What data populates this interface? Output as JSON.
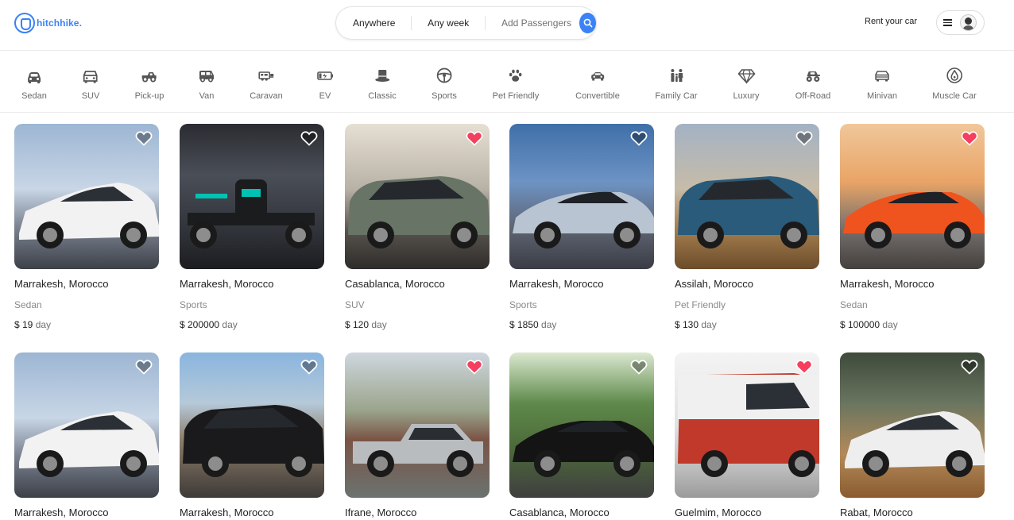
{
  "brand": {
    "name": "hitchhike.",
    "accent": "#3b82f6"
  },
  "search": {
    "where": "Anywhere",
    "when": "Any week",
    "who": "Add Passengers"
  },
  "header": {
    "rent_label": "Rent your car"
  },
  "categories": [
    {
      "label": "Sedan",
      "icon": "sedan-icon"
    },
    {
      "label": "SUV",
      "icon": "suv-icon"
    },
    {
      "label": "Pick-up",
      "icon": "pickup-icon"
    },
    {
      "label": "Van",
      "icon": "van-icon"
    },
    {
      "label": "Caravan",
      "icon": "caravan-icon"
    },
    {
      "label": "EV",
      "icon": "battery-icon"
    },
    {
      "label": "Classic",
      "icon": "top-hat-icon"
    },
    {
      "label": "Sports",
      "icon": "steering-wheel-icon"
    },
    {
      "label": "Pet Friendly",
      "icon": "paw-icon"
    },
    {
      "label": "Convertible",
      "icon": "convertible-icon"
    },
    {
      "label": "Family Car",
      "icon": "family-icon"
    },
    {
      "label": "Luxury",
      "icon": "diamond-icon"
    },
    {
      "label": "Off-Road",
      "icon": "monster-truck-icon"
    },
    {
      "label": "Minivan",
      "icon": "minivan-icon"
    },
    {
      "label": "Muscle Car",
      "icon": "fuel-drop-icon"
    }
  ],
  "listings": [
    {
      "location": "Marrakesh, Morocco",
      "category": "Sedan",
      "price": "$ 19",
      "unit": "day",
      "favorited": false
    },
    {
      "location": "Marrakesh, Morocco",
      "category": "Sports",
      "price": "$ 200000",
      "unit": "day",
      "favorited": false
    },
    {
      "location": "Casablanca, Morocco",
      "category": "SUV",
      "price": "$ 120",
      "unit": "day",
      "favorited": true
    },
    {
      "location": "Marrakesh, Morocco",
      "category": "Sports",
      "price": "$ 1850",
      "unit": "day",
      "favorited": false
    },
    {
      "location": "Assilah, Morocco",
      "category": "Pet Friendly",
      "price": "$ 130",
      "unit": "day",
      "favorited": false
    },
    {
      "location": "Marrakesh, Morocco",
      "category": "Sedan",
      "price": "$ 100000",
      "unit": "day",
      "favorited": true
    },
    {
      "location": "Marrakesh, Morocco",
      "favorited": false
    },
    {
      "location": "Marrakesh, Morocco",
      "favorited": false
    },
    {
      "location": "Ifrane, Morocco",
      "favorited": true
    },
    {
      "location": "Casablanca, Morocco",
      "favorited": false
    },
    {
      "location": "Guelmim, Morocco",
      "favorited": true
    },
    {
      "location": "Rabat, Morocco",
      "favorited": false
    }
  ],
  "colors": {
    "favorite": "#f43f5e",
    "text_muted": "#8a8a8a"
  }
}
